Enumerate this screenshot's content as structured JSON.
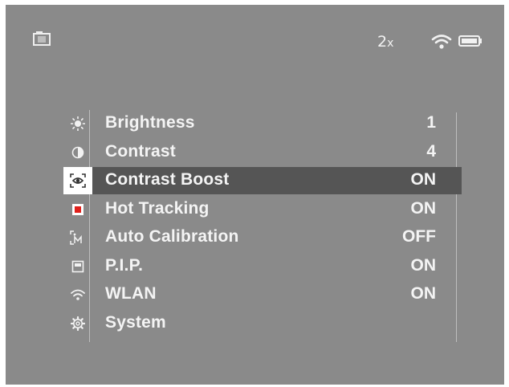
{
  "status": {
    "camera_icon": "camera-icon",
    "zoom_value": "2",
    "zoom_unit": "x",
    "wifi_icon": "wifi-icon",
    "battery_icon": "battery-icon"
  },
  "menu": {
    "selected_index": 2,
    "items": [
      {
        "label": "Brightness",
        "value": "1",
        "icon": "sun-icon"
      },
      {
        "label": "Contrast",
        "value": "4",
        "icon": "half-circle-icon"
      },
      {
        "label": "Contrast Boost",
        "value": "ON",
        "icon": "contrast-boost-icon"
      },
      {
        "label": "Hot Tracking",
        "value": "ON",
        "icon": "hot-tracking-icon"
      },
      {
        "label": "Auto Calibration",
        "value": "OFF",
        "icon": "auto-calibration-icon"
      },
      {
        "label": "P.I.P.",
        "value": "ON",
        "icon": "pip-icon"
      },
      {
        "label": "WLAN",
        "value": "ON",
        "icon": "wlan-icon"
      },
      {
        "label": "System",
        "value": "",
        "icon": "gear-icon"
      }
    ]
  },
  "colors": {
    "screen_bg": "#8a8a8a",
    "selected_row_bg": "#555555",
    "text": "#f4f4f4",
    "hot_tracking_red": "#e0201b"
  }
}
